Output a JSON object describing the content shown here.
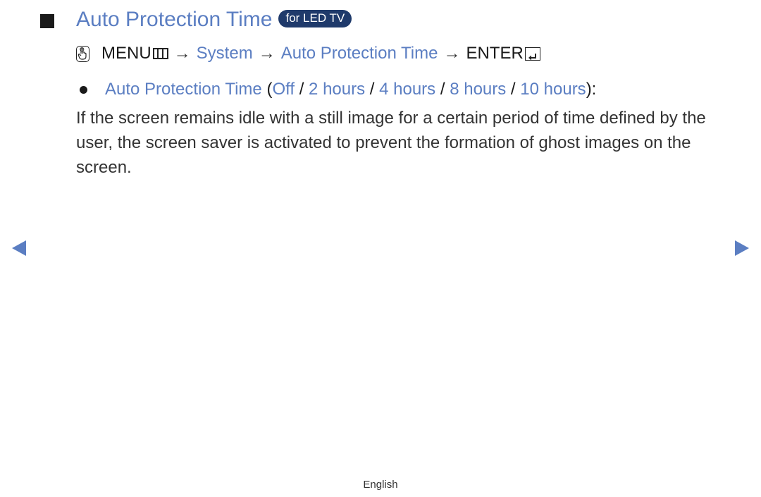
{
  "heading": {
    "title": "Auto Protection Time",
    "badge": "for LED TV"
  },
  "menu_path": {
    "menu_label": "MENU",
    "arrow": "→",
    "items": [
      "System",
      "Auto Protection Time"
    ],
    "enter_label": "ENTER"
  },
  "option_line": {
    "setting": "Auto Protection Time",
    "open_paren": " (",
    "options": [
      "Off",
      "2 hours",
      "4 hours",
      "8 hours",
      "10 hours"
    ],
    "separator": " / ",
    "close": "):"
  },
  "description": "If the screen remains idle with a still image for a certain period of time defined by the user, the screen saver is activated to prevent the formation of ghost images on the screen.",
  "footer": {
    "language": "English"
  },
  "colors": {
    "accent": "#5b7ec2",
    "badge_bg": "#1f3a6b"
  }
}
